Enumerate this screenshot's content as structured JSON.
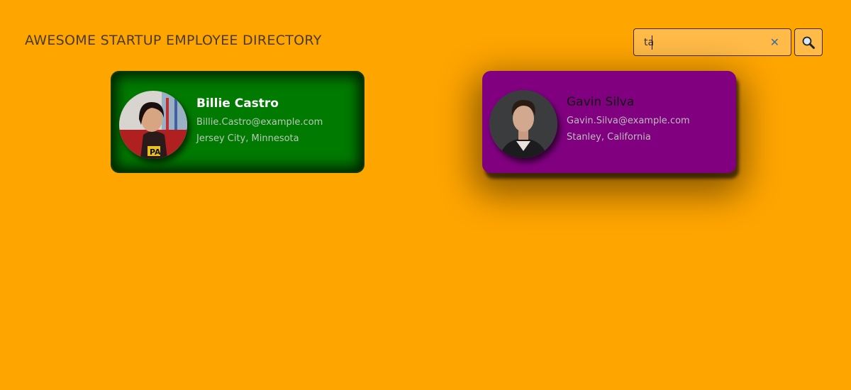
{
  "header": {
    "title": "AWESOME STARTUP EMPLOYEE DIRECTORY"
  },
  "search": {
    "value": "ta",
    "clear_icon": "close-icon",
    "search_icon": "magnifier-icon"
  },
  "employees": [
    {
      "name": "Billie Castro",
      "email": "Billie.Castro@example.com",
      "location": "Jersey City, Minnesota",
      "card_color": "#007A00"
    },
    {
      "name": "Gavin Silva",
      "email": "Gavin.Silva@example.com",
      "location": "Stanley, California",
      "card_color": "#800080"
    }
  ],
  "colors": {
    "background": "#FFA500",
    "search_bg": "#FFBA47"
  }
}
